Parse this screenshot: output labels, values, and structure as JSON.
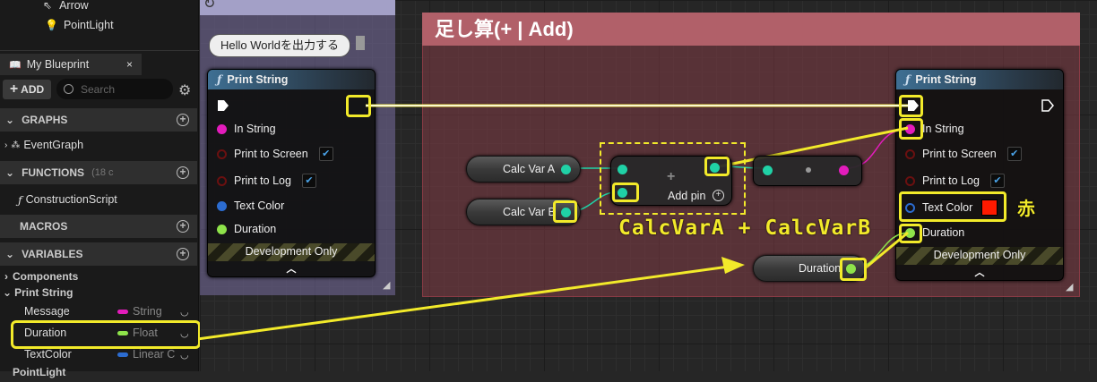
{
  "left_panel": {
    "tree_items": [
      "Arrow",
      "PointLight"
    ],
    "tab_title": "My Blueprint",
    "tab_close": "×",
    "add_label": "ADD",
    "search_placeholder": "Search",
    "sections": {
      "graphs": "GRAPHS",
      "graph_item": "EventGraph",
      "functions": "FUNCTIONS",
      "functions_count": "(18 c",
      "function_item": "ConstructionScript",
      "macros": "MACROS",
      "variables": "VARIABLES"
    },
    "categories": [
      "Components",
      "Print String"
    ],
    "variables": [
      {
        "name": "Message",
        "type": "String",
        "color": "#e31cbc"
      },
      {
        "name": "Duration",
        "type": "Float",
        "color": "#8ee34a"
      },
      {
        "name": "TextColor",
        "type": "Linear C",
        "color": "#2c6cd0"
      }
    ],
    "bottom_cut": "PointLight"
  },
  "graph": {
    "comment_red_title": "足し算(+ | Add)",
    "bubble_text": "Hello Worldを出力する",
    "left_print": {
      "title": "Print String",
      "pins": [
        "In String",
        "Print to Screen",
        "Print to Log",
        "Text Color",
        "Duration"
      ],
      "dev_only": "Development Only"
    },
    "right_print": {
      "title": "Print String",
      "pins": [
        "In String",
        "Print to Screen",
        "Print to Log",
        "Text Color",
        "Duration"
      ],
      "dev_only": "Development Only"
    },
    "getters": {
      "calc_a": "Calc Var A",
      "calc_b": "Calc Var B",
      "duration": "Duration"
    },
    "add_pin": "Add pin",
    "annotation_calc": "CalcVarA + CalcVarB",
    "annotation_red": "赤",
    "colors": {
      "string_pin": "#e31cbc",
      "float_pin": "#8ee34a",
      "int_pin": "#20d1a6",
      "linear_color_pin": "#2c6cd0",
      "highlight": "#f2ea2a",
      "text_color_swatch": "#ff1a00"
    }
  }
}
